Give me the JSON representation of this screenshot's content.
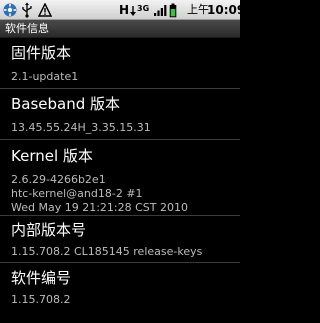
{
  "status_bar": {
    "icons": [
      "settings-gear-icon",
      "usb-icon",
      "warning-icon",
      "htc-sync-icon",
      "3g-icon",
      "signal-icon",
      "battery-icon"
    ],
    "sync_letter": "H",
    "network": "3G",
    "time_prefix": "上午",
    "time": "10:09"
  },
  "title_bar": {
    "title": "软件信息"
  },
  "items": [
    {
      "title": "固件版本",
      "summary": [
        "2.1-update1"
      ]
    },
    {
      "title": "Baseband 版本",
      "summary": [
        "13.45.55.24H_3.35.15.31"
      ]
    },
    {
      "title": "Kernel 版本",
      "summary": [
        "2.6.29-4266b2e1",
        "htc-kernel@and18-2 #1",
        "Wed May 19 21:21:28 CST 2010"
      ]
    },
    {
      "title": "内部版本号",
      "summary": [
        "1.15.708.2 CL185145 release-keys"
      ]
    },
    {
      "title": "软件编号",
      "summary": [
        "1.15.708.2"
      ]
    }
  ]
}
